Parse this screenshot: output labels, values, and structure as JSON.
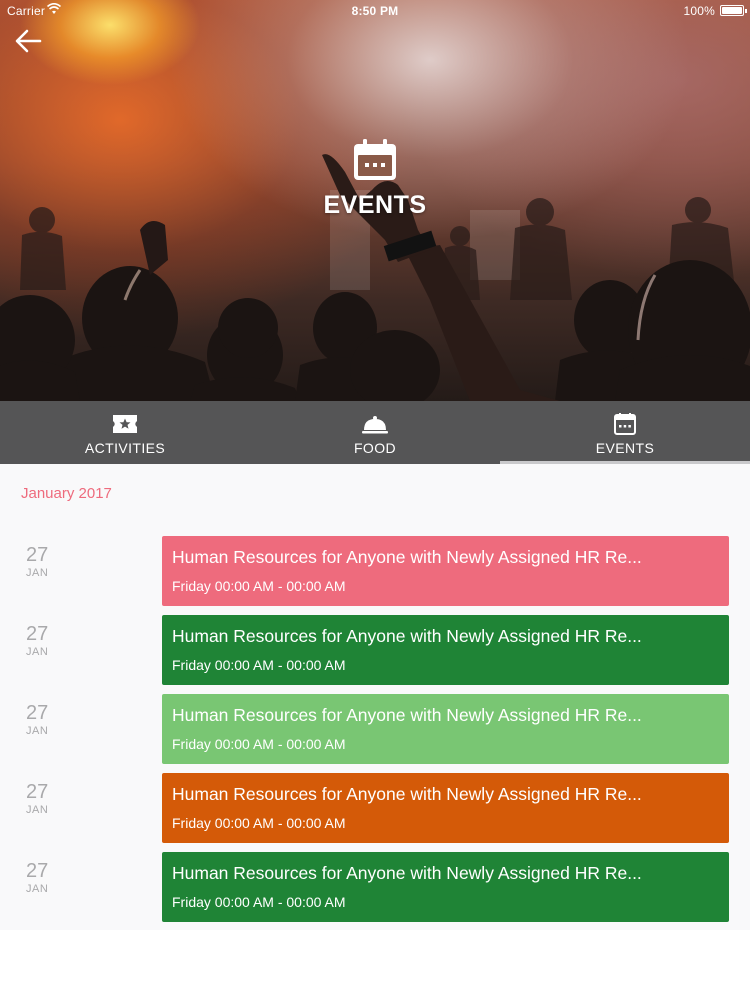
{
  "status_bar": {
    "carrier": "Carrier",
    "time": "8:50 PM",
    "battery": "100%"
  },
  "header": {
    "title": "EVENTS",
    "back_icon": "arrow-left-icon",
    "title_icon": "calendar-icon"
  },
  "tabs": [
    {
      "label": "ACTIVITIES",
      "icon": "ticket-star-icon",
      "active": false
    },
    {
      "label": "FOOD",
      "icon": "cloche-icon",
      "active": false
    },
    {
      "label": "EVENTS",
      "icon": "calendar-icon",
      "active": true
    }
  ],
  "content": {
    "month": "January 2017",
    "events": [
      {
        "day": "27",
        "month": "JAN",
        "title": "Human Resources for Anyone with Newly Assigned HR Re...",
        "time": "Friday 00:00 AM - 00:00 AM",
        "color": "#ee6b7d"
      },
      {
        "day": "27",
        "month": "JAN",
        "title": "Human Resources for Anyone with Newly Assigned HR Re...",
        "time": "Friday 00:00 AM - 00:00 AM",
        "color": "#1f8436"
      },
      {
        "day": "27",
        "month": "JAN",
        "title": "Human Resources for Anyone with Newly Assigned HR Re...",
        "time": "Friday 00:00 AM - 00:00 AM",
        "color": "#79c673"
      },
      {
        "day": "27",
        "month": "JAN",
        "title": "Human Resources for Anyone with Newly Assigned HR Re...",
        "time": "Friday 00:00 AM - 00:00 AM",
        "color": "#d45a08"
      },
      {
        "day": "27",
        "month": "JAN",
        "title": "Human Resources for Anyone with Newly Assigned HR Re...",
        "time": "Friday 00:00 AM - 00:00 AM",
        "color": "#1f8436"
      }
    ]
  },
  "colors": {
    "tab_bar": "#555556",
    "accent": "#ee6b7d",
    "date_text": "#a9a9ab"
  }
}
